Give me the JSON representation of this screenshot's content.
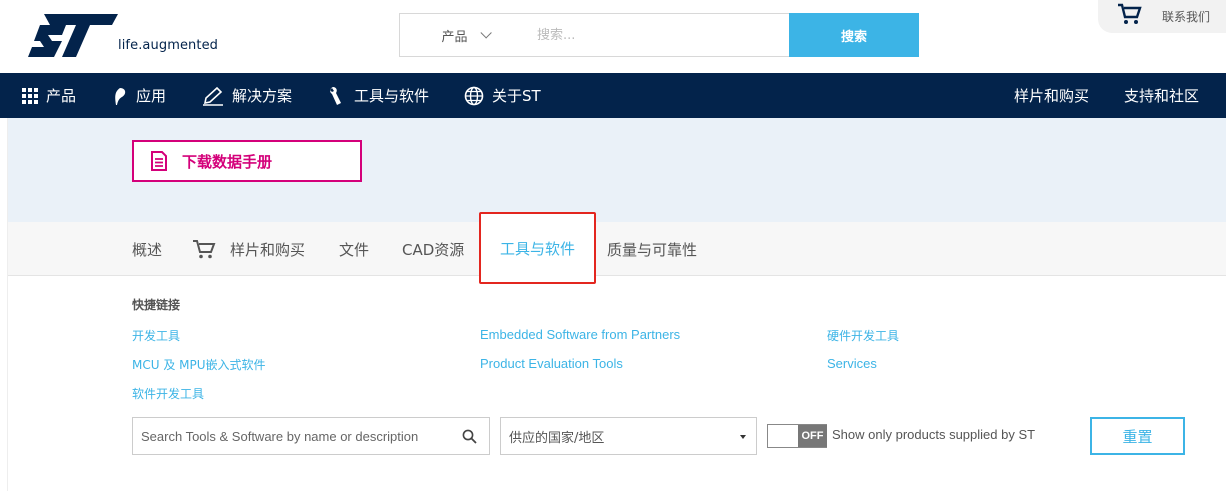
{
  "header": {
    "tagline": "life.augmented",
    "search_category": "产品",
    "search_placeholder": "搜索...",
    "search_button": "搜索",
    "contact": "联系我们"
  },
  "nav": {
    "left": [
      {
        "label": "产品",
        "icon": "grid-icon"
      },
      {
        "label": "应用",
        "icon": "leaf-icon"
      },
      {
        "label": "解决方案",
        "icon": "pencil-icon"
      },
      {
        "label": "工具与软件",
        "icon": "wrench-icon"
      },
      {
        "label": "关于ST",
        "icon": "globe-icon"
      }
    ],
    "right": [
      "样片和购买",
      "支持和社区"
    ]
  },
  "hero": {
    "download_button": "下载数据手册"
  },
  "tabs": {
    "items": [
      "概述",
      "样片和购买",
      "文件",
      "CAD资源",
      "工具与软件",
      "质量与可靠性"
    ],
    "active": "工具与软件"
  },
  "quick_links": {
    "title": "快捷链接",
    "links": [
      "开发工具",
      "MCU 及 MPU嵌入式软件",
      "软件开发工具",
      "Embedded Software from Partners",
      "Product Evaluation Tools",
      "硬件开发工具",
      "Services"
    ]
  },
  "filter": {
    "search_placeholder": "Search Tools & Software by name or description",
    "country_select": "供应的国家/地区",
    "toggle_state": "OFF",
    "toggle_label": "Show only products supplied by ST",
    "reset_button": "重置"
  },
  "colors": {
    "navy": "#03234b",
    "accent_blue": "#3cb4e6",
    "magenta": "#d4007a",
    "highlight_red": "#e3261f"
  }
}
